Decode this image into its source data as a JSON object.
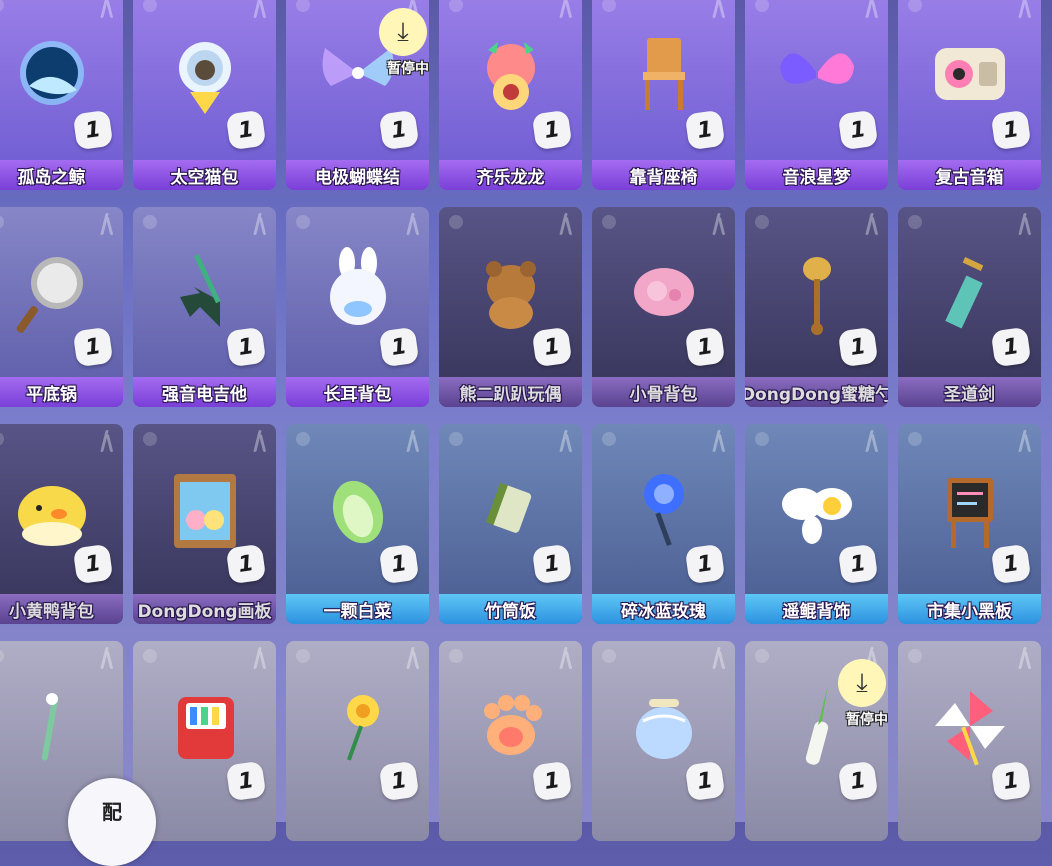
{
  "rows": [
    {
      "items": [
        {
          "name": "孤岛之鲸",
          "qty": "1",
          "style": "purple",
          "icon": "whale-moon-icon"
        },
        {
          "name": "太空猫包",
          "qty": "1",
          "style": "purple",
          "icon": "space-cat-backpack-icon"
        },
        {
          "name": "电极蝴蝶结",
          "qty": "1",
          "style": "purple",
          "icon": "electric-bow-icon",
          "paused": true
        },
        {
          "name": "齐乐龙龙",
          "qty": "1",
          "style": "purple",
          "icon": "dragon-plush-icon"
        },
        {
          "name": "靠背座椅",
          "qty": "1",
          "style": "purple",
          "icon": "chair-icon"
        },
        {
          "name": "音浪星梦",
          "qty": "1",
          "style": "purple",
          "icon": "star-wings-icon"
        },
        {
          "name": "复古音箱",
          "qty": "1",
          "style": "purple",
          "icon": "retro-speaker-icon"
        }
      ]
    },
    {
      "items": [
        {
          "name": "平底锅",
          "qty": "1",
          "style": "purple",
          "icon": "frying-pan-icon"
        },
        {
          "name": "强音电吉他",
          "qty": "1",
          "style": "purple",
          "icon": "electric-guitar-icon"
        },
        {
          "name": "长耳背包",
          "qty": "1",
          "style": "purple",
          "icon": "bunny-backpack-icon"
        },
        {
          "name": "熊二趴趴玩偶",
          "qty": "1",
          "style": "dim",
          "icon": "bear-plush-icon"
        },
        {
          "name": "小骨背包",
          "qty": "1",
          "style": "dim",
          "icon": "pink-backpack-icon"
        },
        {
          "name": "DongDong蜜糖勺",
          "qty": "1",
          "style": "dim",
          "icon": "honey-dipper-icon"
        },
        {
          "name": "圣道剑",
          "qty": "1",
          "style": "dim",
          "icon": "sword-icon"
        }
      ]
    },
    {
      "items": [
        {
          "name": "小黄鸭背包",
          "qty": "1",
          "style": "dim",
          "icon": "duck-backpack-icon"
        },
        {
          "name": "DongDong画板",
          "qty": "1",
          "style": "dim",
          "icon": "drawing-board-icon"
        },
        {
          "name": "一颗白菜",
          "qty": "1",
          "style": "blue",
          "icon": "cabbage-icon"
        },
        {
          "name": "竹筒饭",
          "qty": "1",
          "style": "blue",
          "icon": "bamboo-rice-icon"
        },
        {
          "name": "碎冰蓝玫瑰",
          "qty": "1",
          "style": "blue",
          "icon": "blue-rose-icon"
        },
        {
          "name": "遥鲲背饰",
          "qty": "1",
          "style": "blue",
          "icon": "egg-wings-icon"
        },
        {
          "name": "市集小黑板",
          "qty": "1",
          "style": "blue",
          "icon": "blackboard-icon"
        }
      ]
    },
    {
      "items": [
        {
          "name": "",
          "qty": "",
          "style": "blue",
          "icon": "wand-icon"
        },
        {
          "name": "",
          "qty": "1",
          "style": "blue",
          "icon": "crayon-box-icon"
        },
        {
          "name": "",
          "qty": "1",
          "style": "blue",
          "icon": "sunflower-icon"
        },
        {
          "name": "",
          "qty": "1",
          "style": "blue",
          "icon": "paw-icon"
        },
        {
          "name": "",
          "qty": "1",
          "style": "blue",
          "icon": "coin-purse-icon"
        },
        {
          "name": "",
          "qty": "1",
          "style": "blue",
          "icon": "leek-icon",
          "paused": true
        },
        {
          "name": "",
          "qty": "1",
          "style": "blue",
          "icon": "pinwheel-icon"
        }
      ]
    }
  ],
  "pause_label": "暂停中",
  "match_button_label": "配",
  "colors": {
    "purple_label": "#7a3fd8",
    "blue_label": "#2d92e0",
    "qty_badge": "#f4f4f6"
  }
}
